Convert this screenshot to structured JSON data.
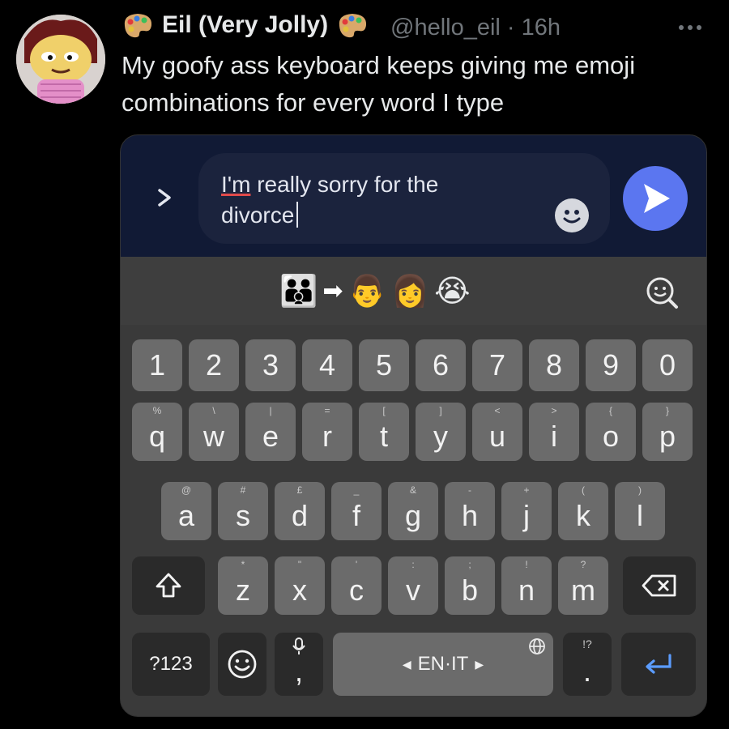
{
  "tweet": {
    "display_name": "Eil (Very Jolly)",
    "handle_line": "@hello_eil · 16h",
    "text": "My goofy ass keyboard keeps giving me emoji combinations for every word I type"
  },
  "compose": {
    "typed_text_1": "I'm",
    "typed_text_2": " really sorry for the",
    "typed_text_3": "divorce"
  },
  "suggestion": {
    "emoji_combo": [
      "👪",
      "➡",
      "👨",
      "👩",
      "😭"
    ]
  },
  "keyboard": {
    "number_row": [
      "1",
      "2",
      "3",
      "4",
      "5",
      "6",
      "7",
      "8",
      "9",
      "0"
    ],
    "row1": [
      {
        "k": "q",
        "h": "%"
      },
      {
        "k": "w",
        "h": "\\"
      },
      {
        "k": "e",
        "h": "|"
      },
      {
        "k": "r",
        "h": "="
      },
      {
        "k": "t",
        "h": "["
      },
      {
        "k": "y",
        "h": "]"
      },
      {
        "k": "u",
        "h": "<"
      },
      {
        "k": "i",
        "h": ">"
      },
      {
        "k": "o",
        "h": "{"
      },
      {
        "k": "p",
        "h": "}"
      }
    ],
    "row2": [
      {
        "k": "a",
        "h": "@"
      },
      {
        "k": "s",
        "h": "#"
      },
      {
        "k": "d",
        "h": "£"
      },
      {
        "k": "f",
        "h": "_"
      },
      {
        "k": "g",
        "h": "&"
      },
      {
        "k": "h",
        "h": "-"
      },
      {
        "k": "j",
        "h": "+"
      },
      {
        "k": "k",
        "h": "("
      },
      {
        "k": "l",
        "h": ")"
      }
    ],
    "row3": [
      {
        "k": "z",
        "h": "*"
      },
      {
        "k": "x",
        "h": "\""
      },
      {
        "k": "c",
        "h": "'"
      },
      {
        "k": "v",
        "h": ":"
      },
      {
        "k": "b",
        "h": ";"
      },
      {
        "k": "n",
        "h": "!"
      },
      {
        "k": "m",
        "h": "?"
      }
    ],
    "symbols_label": "?123",
    "comma": ",",
    "space_label": "EN·IT",
    "period": ".",
    "period_hint": "!?"
  }
}
